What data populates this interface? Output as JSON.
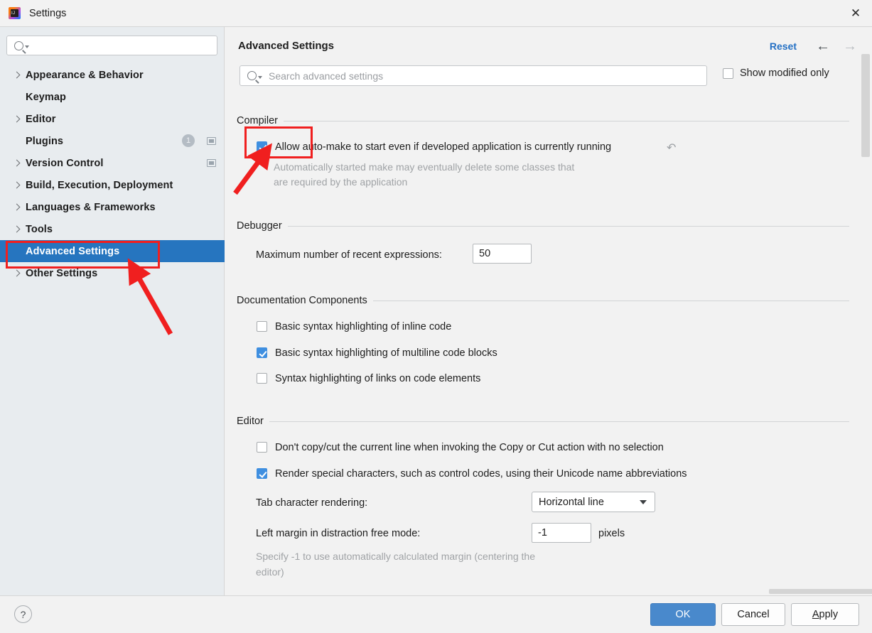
{
  "window": {
    "title": "Settings",
    "app_icon": "intellij-idea-icon",
    "close_icon": "close-icon"
  },
  "sidebar": {
    "search": {
      "value": "",
      "placeholder": "",
      "icon": "search-icon"
    },
    "items": [
      {
        "label": "Appearance & Behavior",
        "expandable": true,
        "selected": false,
        "badge": null,
        "project_icon": false
      },
      {
        "label": "Keymap",
        "expandable": false,
        "selected": false,
        "badge": null,
        "project_icon": false
      },
      {
        "label": "Editor",
        "expandable": true,
        "selected": false,
        "badge": null,
        "project_icon": false
      },
      {
        "label": "Plugins",
        "expandable": false,
        "selected": false,
        "badge": "1",
        "project_icon": true
      },
      {
        "label": "Version Control",
        "expandable": true,
        "selected": false,
        "badge": null,
        "project_icon": true
      },
      {
        "label": "Build, Execution, Deployment",
        "expandable": true,
        "selected": false,
        "badge": null,
        "project_icon": false
      },
      {
        "label": "Languages & Frameworks",
        "expandable": true,
        "selected": false,
        "badge": null,
        "project_icon": false
      },
      {
        "label": "Tools",
        "expandable": true,
        "selected": false,
        "badge": null,
        "project_icon": false
      },
      {
        "label": "Advanced Settings",
        "expandable": false,
        "selected": true,
        "badge": null,
        "project_icon": false
      },
      {
        "label": "Other Settings",
        "expandable": true,
        "selected": false,
        "badge": null,
        "project_icon": false
      }
    ]
  },
  "main": {
    "title": "Advanced Settings",
    "reset_label": "Reset",
    "back_icon": "arrow-left-icon",
    "forward_icon": "arrow-right-icon",
    "search": {
      "value": "",
      "placeholder": "Search advanced settings",
      "icon": "search-icon"
    },
    "show_modified_only": {
      "label": "Show modified only",
      "checked": false
    },
    "sections": {
      "compiler": {
        "title": "Compiler",
        "option_label": "Allow auto-make to start even if developed application is currently running",
        "option_checked": true,
        "revert_icon": "revert-icon",
        "help_line1": "Automatically started make may eventually delete some classes that",
        "help_line2": "are required by the application"
      },
      "debugger": {
        "title": "Debugger",
        "field_label": "Maximum number of recent expressions:",
        "field_value": "50"
      },
      "documentation": {
        "title": "Documentation Components",
        "options": [
          {
            "label": "Basic syntax highlighting of inline code",
            "checked": false
          },
          {
            "label": "Basic syntax highlighting of multiline code blocks",
            "checked": true
          },
          {
            "label": "Syntax highlighting of links on code elements",
            "checked": false
          }
        ]
      },
      "editor": {
        "title": "Editor",
        "options": [
          {
            "label": "Don't copy/cut the current line when invoking the Copy or Cut action with no selection",
            "checked": false
          },
          {
            "label": "Render special characters, such as control codes, using their Unicode name abbreviations",
            "checked": true
          }
        ],
        "tab_rendering_label": "Tab character rendering:",
        "tab_rendering_value": "Horizontal line",
        "left_margin_label": "Left margin in distraction free mode:",
        "left_margin_value": "-1",
        "left_margin_units": "pixels",
        "left_margin_help_line1": "Specify -1 to use automatically calculated margin (centering the",
        "left_margin_help_line2": "editor)"
      }
    }
  },
  "footer": {
    "help_label": "?",
    "ok_label": "OK",
    "cancel_label": "Cancel",
    "apply_label_underlined": "A",
    "apply_label_rest": "pply"
  },
  "colors": {
    "accent_blue": "#2675bf",
    "link_blue": "#2470c4",
    "checkbox_blue": "#3f8fe0",
    "ok_button_blue": "#4989cc",
    "annotation_red": "#f01f1f",
    "sidebar_bg": "#e8ecef",
    "panel_bg": "#f2f2f2"
  }
}
